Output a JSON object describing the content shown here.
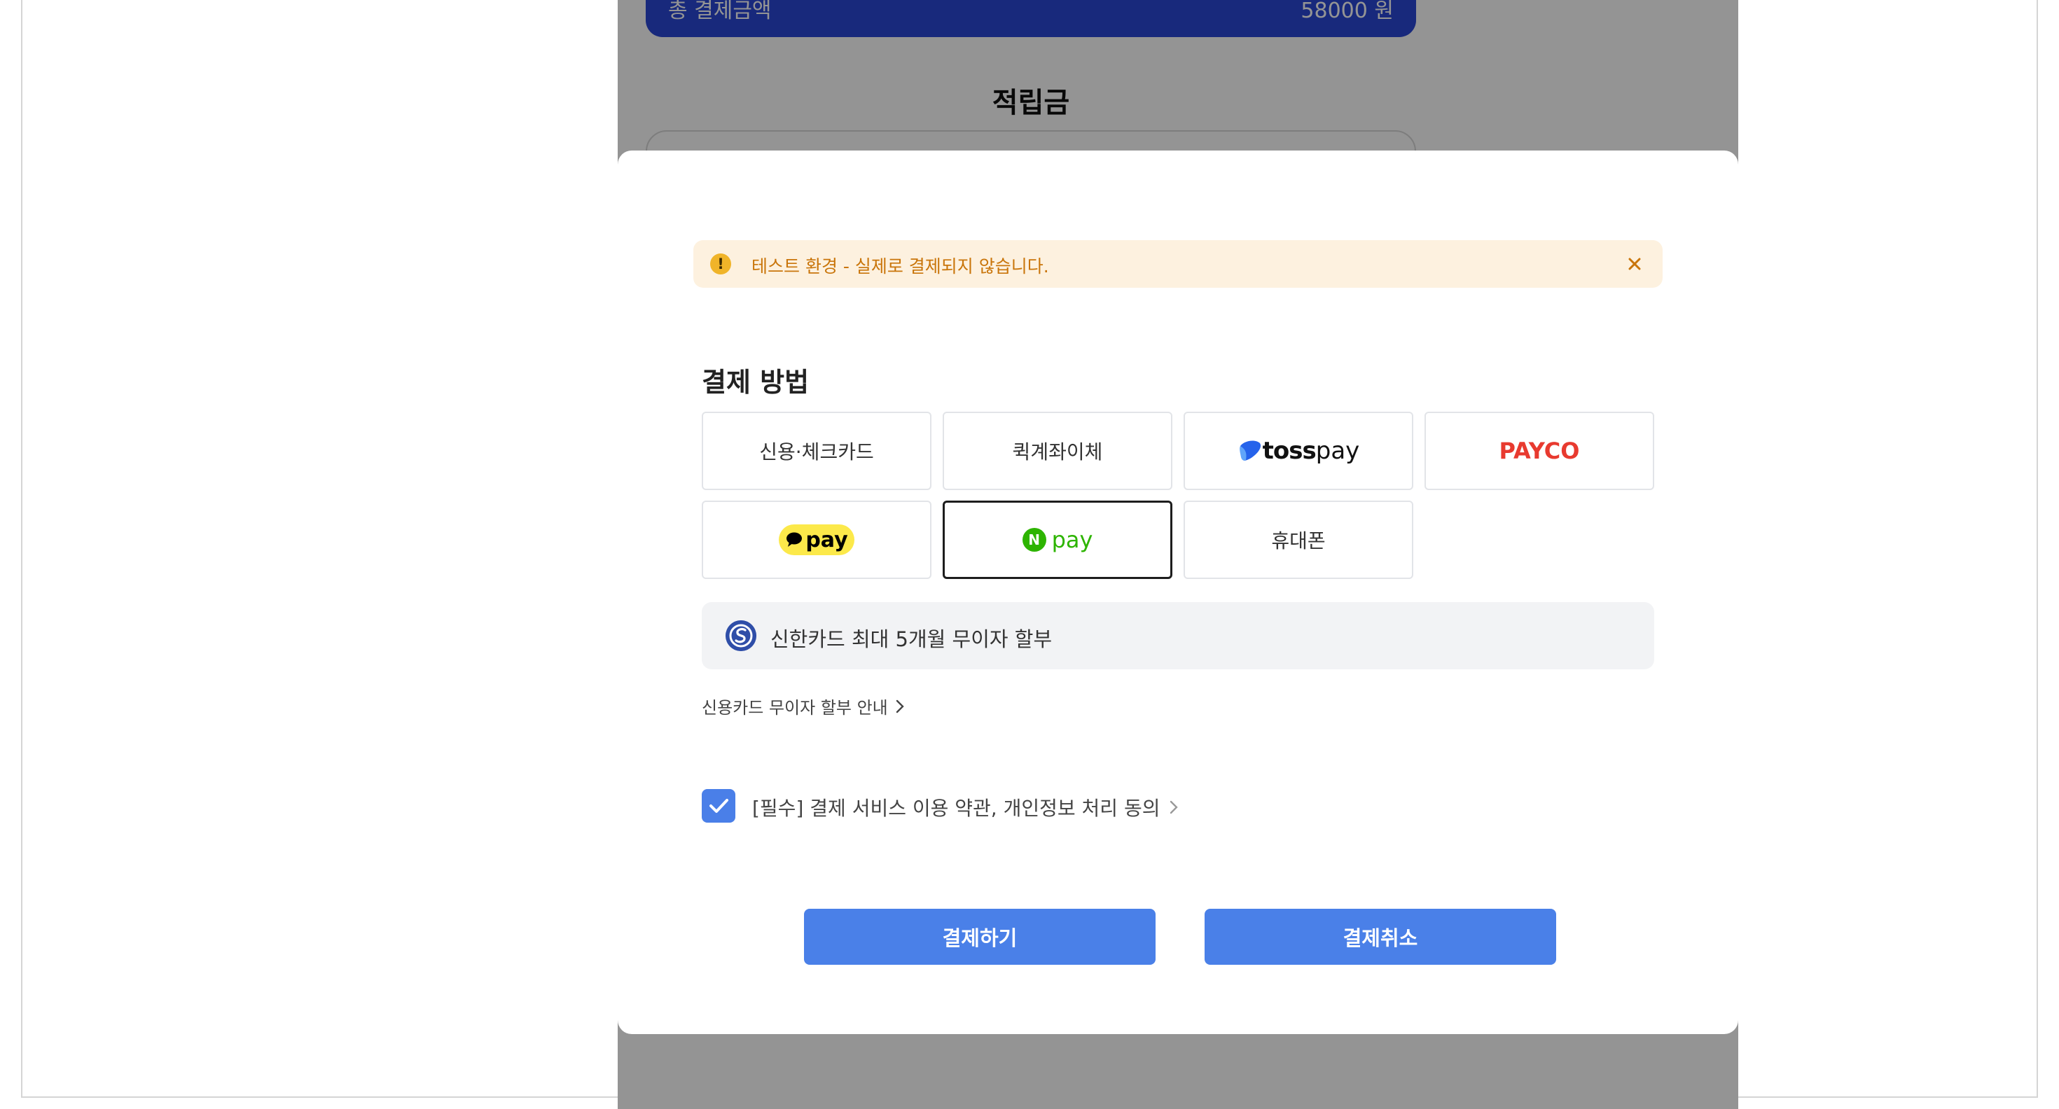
{
  "checkout": {
    "total_label": "총 결제금액",
    "total_amount": "58000 원",
    "points_title": "적립금"
  },
  "notice": {
    "icon_glyph": "!",
    "text": "테스트 환경 - 실제로 결제되지 않습니다."
  },
  "payment": {
    "section_title": "결제 방법",
    "methods": {
      "card": "신용·체크카드",
      "transfer": "퀵계좌이체",
      "toss_brand": "toss",
      "toss_pay": "pay",
      "payco": "PAYCO",
      "kakao_pay": "pay",
      "naver_n": "N",
      "naver_pay": "pay",
      "phone": "휴대폰"
    },
    "selected_method": "naver_pay",
    "promo_text": "신한카드 최대 5개월 무이자 할부",
    "installment_link": "신용카드 무이자 할부 안내",
    "agreement_text": "[필수] 결제 서비스 이용 약관, 개인정보 처리 동의",
    "agreement_checked": true,
    "pay_button": "결제하기",
    "cancel_button": "결제취소"
  },
  "colors": {
    "primary_button": "#4a80e8",
    "notice_bg": "#fdf1df",
    "notice_text": "#c9750a",
    "payco_red": "#e83a2f",
    "naver_green": "#2db400",
    "kakao_yellow": "#fce94a"
  }
}
